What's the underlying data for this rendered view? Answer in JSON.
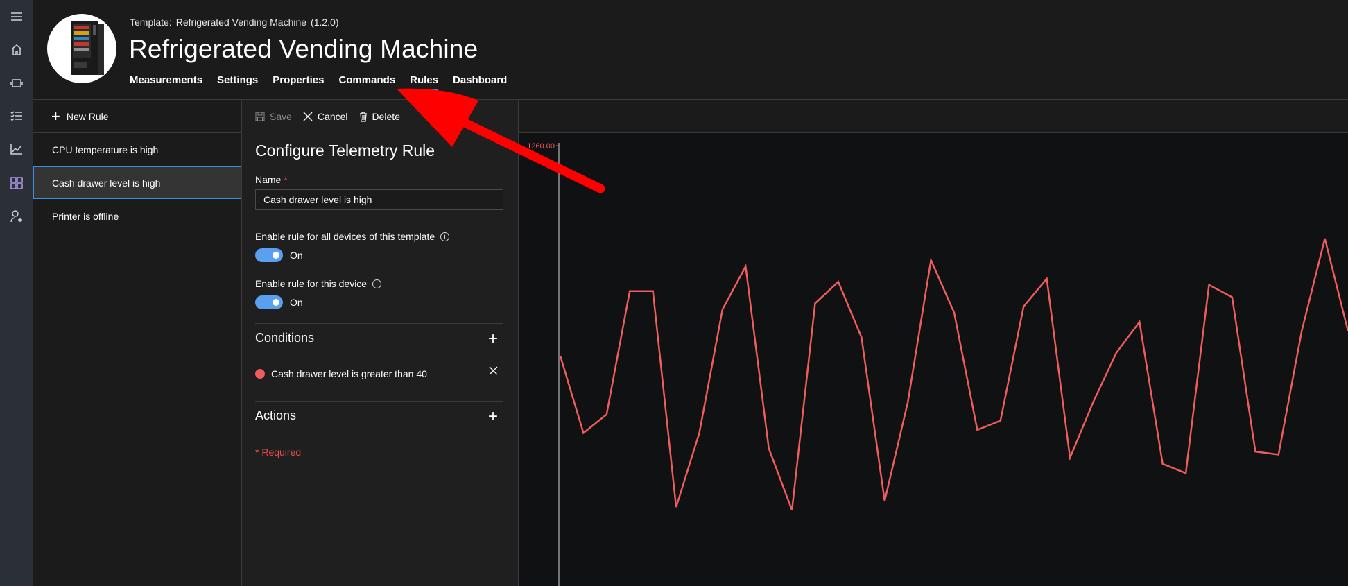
{
  "header": {
    "template_label": "Template:",
    "template_name": "Refrigerated Vending Machine",
    "template_version": "(1.2.0)",
    "device_title": "Refrigerated Vending Machine",
    "tabs": [
      {
        "label": "Measurements",
        "active": false
      },
      {
        "label": "Settings",
        "active": false
      },
      {
        "label": "Properties",
        "active": false
      },
      {
        "label": "Commands",
        "active": false
      },
      {
        "label": "Rules",
        "active": true
      },
      {
        "label": "Dashboard",
        "active": false
      }
    ]
  },
  "rail": {
    "icons": [
      "menu-icon",
      "home-icon",
      "devices-icon",
      "rules-list-icon",
      "analytics-icon",
      "dashboard-icon",
      "admin-icon"
    ]
  },
  "rules_panel": {
    "new_rule_label": "New Rule",
    "items": [
      {
        "label": "CPU temperature is high",
        "selected": false
      },
      {
        "label": "Cash drawer level is high",
        "selected": true
      },
      {
        "label": "Printer is offline",
        "selected": false
      }
    ]
  },
  "config": {
    "toolbar": {
      "save": "Save",
      "cancel": "Cancel",
      "delete": "Delete"
    },
    "title": "Configure Telemetry Rule",
    "name_label": "Name",
    "required_marker": "*",
    "name_value": "Cash drawer level is high",
    "enable_all_label": "Enable rule for all devices of this template",
    "enable_all_state": "On",
    "enable_device_label": "Enable rule for this device",
    "enable_device_state": "On",
    "info_glyph": "i",
    "conditions_title": "Conditions",
    "condition_text": "Cash drawer level is greater than 40",
    "actions_title": "Actions",
    "required_note": "* Required"
  },
  "colors": {
    "accent": "#3a8ee6",
    "toggle_on": "#5aa0f0",
    "series": "#ef5c5c",
    "annotation_arrow": "#ff0000"
  },
  "chart_data": {
    "type": "line",
    "y_max_label": "1260.00",
    "series": [
      {
        "values": [
          0.62,
          0.37,
          0.43,
          0.83,
          0.83,
          0.13,
          0.37,
          0.77,
          0.91,
          0.32,
          0.12,
          0.79,
          0.86,
          0.68,
          0.15,
          0.47,
          0.93,
          0.76,
          0.38,
          0.41,
          0.78,
          0.87,
          0.29,
          0.47,
          0.63,
          0.73,
          0.27,
          0.24,
          0.85,
          0.81,
          0.31,
          0.3,
          0.7,
          1.0,
          0.7
        ]
      }
    ]
  }
}
